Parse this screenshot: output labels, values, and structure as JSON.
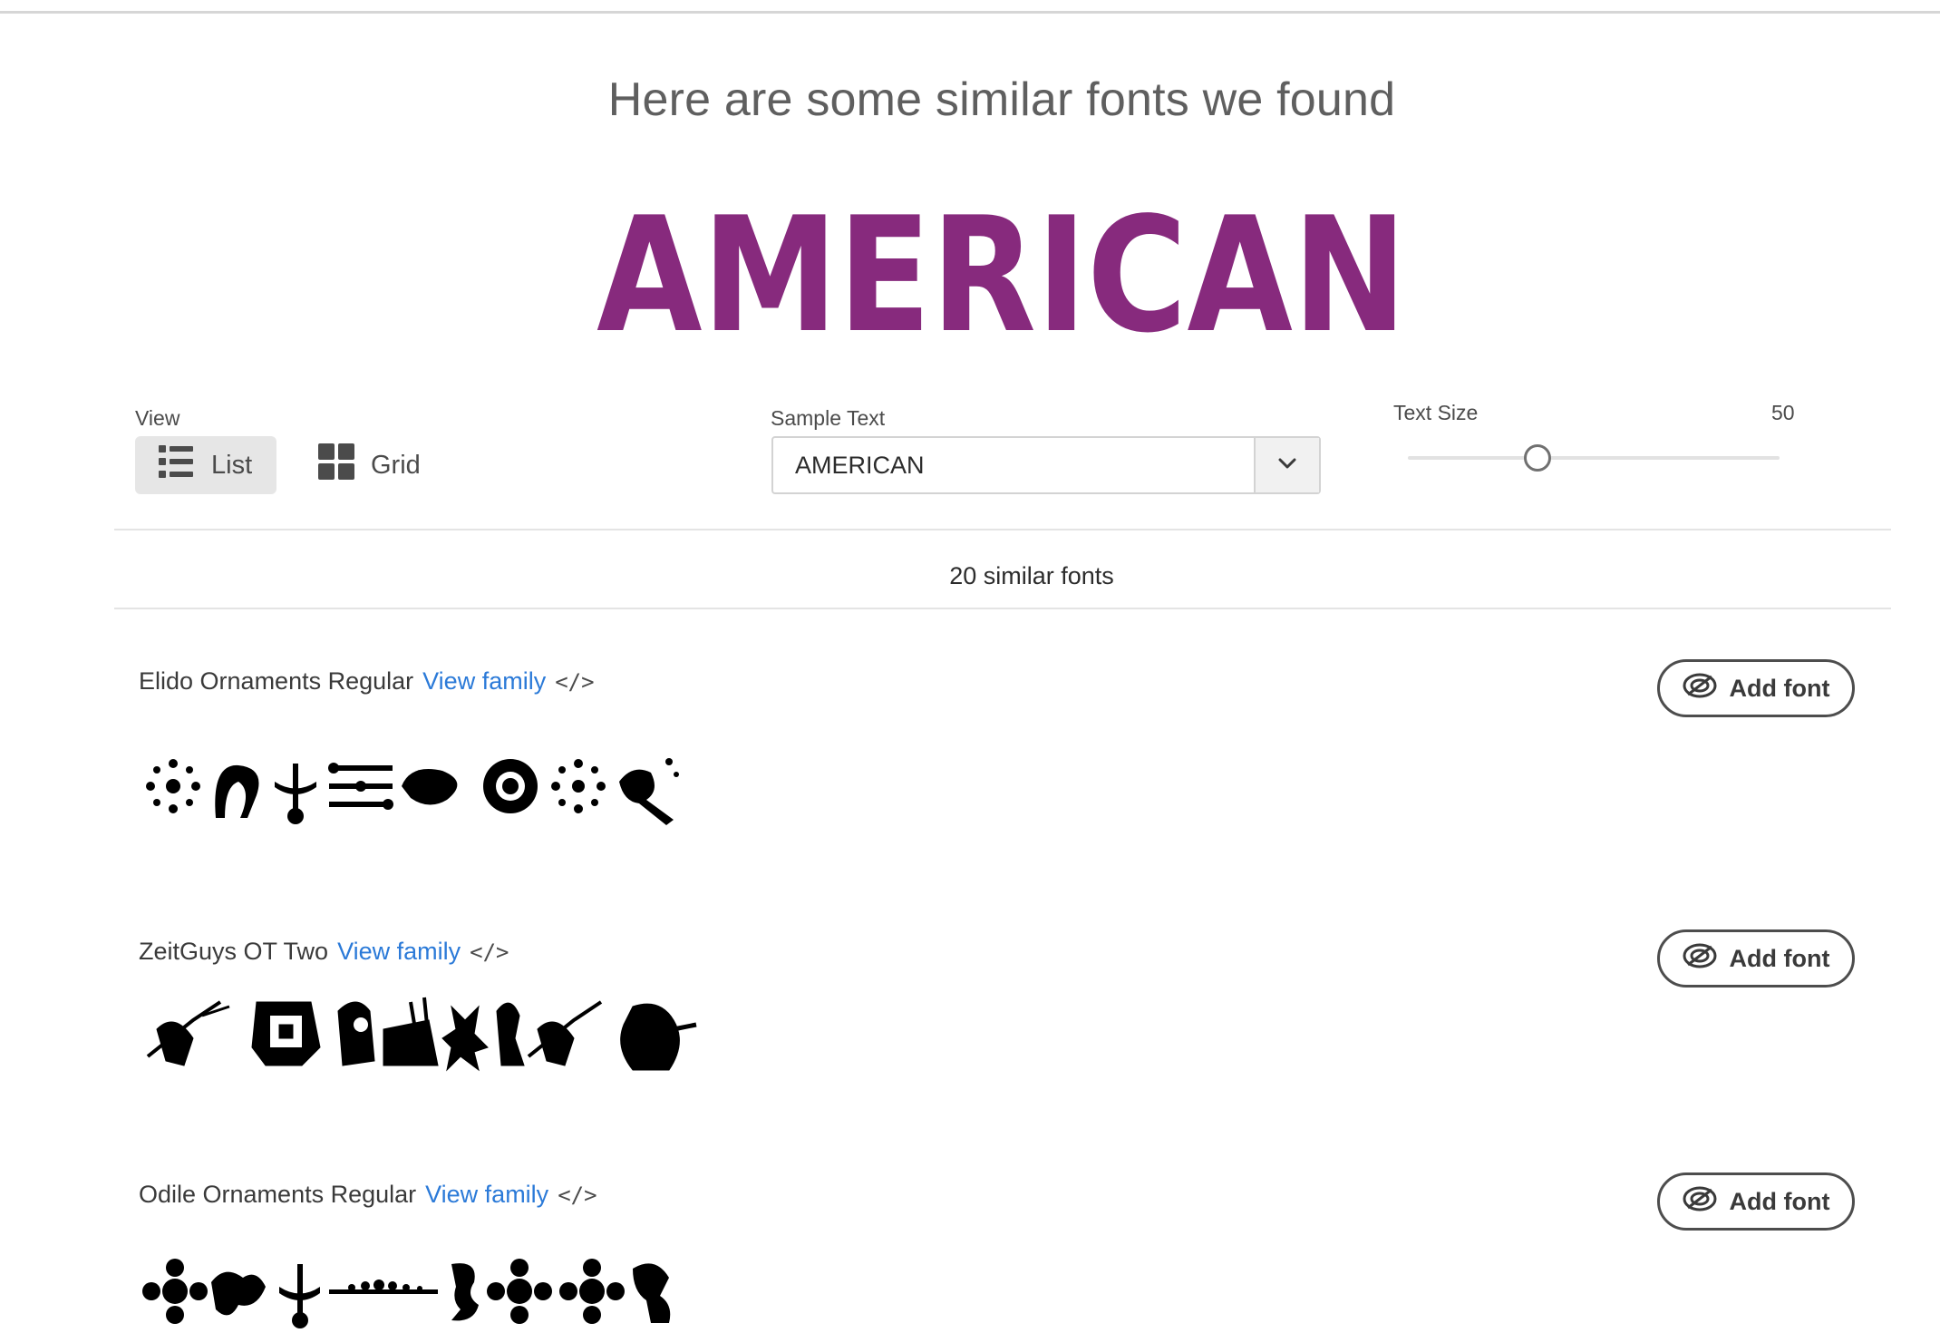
{
  "header": {
    "title": "Here are some similar fonts we found"
  },
  "preview": {
    "text": "AMERICAN",
    "color": "#872a7d"
  },
  "controls": {
    "view": {
      "label": "View",
      "options": [
        {
          "label": "List",
          "icon": "list-icon",
          "selected": true
        },
        {
          "label": "Grid",
          "icon": "grid-icon",
          "selected": false
        }
      ]
    },
    "sample_text": {
      "label": "Sample Text",
      "value": "AMERICAN",
      "icon": "chevron-down-icon"
    },
    "text_size": {
      "label": "Text Size",
      "value": "50"
    }
  },
  "results": {
    "count_text": "20 similar fonts",
    "fonts": [
      {
        "name": "Elido Ornaments Regular",
        "view_family": "View family",
        "code": "</>",
        "add_label": "Add font"
      },
      {
        "name": "ZeitGuys OT Two",
        "view_family": "View family",
        "code": "</>",
        "add_label": "Add font"
      },
      {
        "name": "Odile Ornaments Regular",
        "view_family": "View family",
        "code": "</>",
        "add_label": "Add font"
      }
    ]
  },
  "colors": {
    "accent_link": "#2b7ad8",
    "title_gray": "#5f5f5f"
  }
}
